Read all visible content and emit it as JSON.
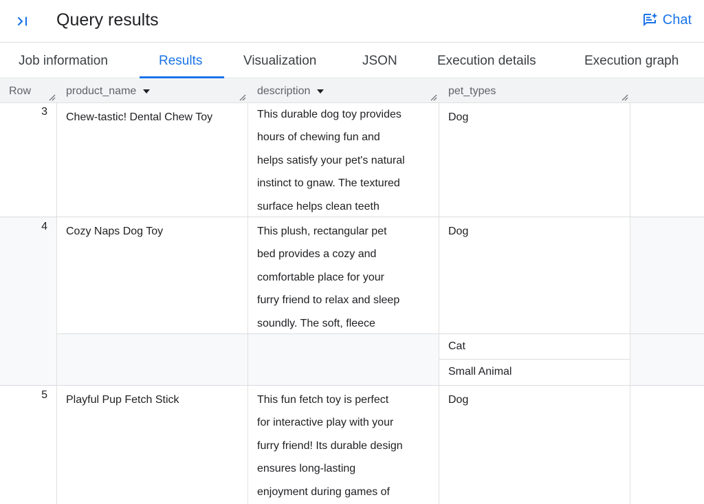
{
  "header": {
    "collapse_icon": "collapse-panel-icon",
    "title": "Query results",
    "chat_label": "Chat",
    "chat_icon": "chat-spark-icon"
  },
  "tabs": [
    {
      "label": "Job information",
      "active": false
    },
    {
      "label": "Results",
      "active": true
    },
    {
      "label": "Visualization",
      "active": false
    },
    {
      "label": "JSON",
      "active": false
    },
    {
      "label": "Execution details",
      "active": false
    },
    {
      "label": "Execution graph",
      "active": false
    }
  ],
  "columns": {
    "row": "Row",
    "product_name": "product_name",
    "description": "description",
    "pet_types": "pet_types"
  },
  "rows": [
    {
      "row": "3",
      "product_name": "Chew-tastic! Dental Chew Toy",
      "description": [
        "This durable dog toy provides",
        "hours of chewing fun and",
        "helps satisfy your pet's natural",
        "instinct to gnaw.  The textured",
        "surface helps clean teeth"
      ],
      "pet_types": [
        "Dog"
      ]
    },
    {
      "row": "4",
      "product_name": "Cozy Naps Dog Toy",
      "description": [
        "This plush, rectangular pet",
        "bed provides a cozy and",
        "comfortable place for your",
        "furry friend to relax and sleep",
        "soundly. The soft, fleece"
      ],
      "pet_types": [
        "Dog",
        "Cat",
        "Small Animal"
      ]
    },
    {
      "row": "5",
      "product_name": "Playful Pup Fetch Stick",
      "description": [
        "This fun fetch toy is perfect",
        "for interactive play with your",
        "furry friend!  Its durable design",
        "ensures long-lasting",
        "enjoyment during games of"
      ],
      "pet_types": [
        "Dog"
      ]
    }
  ],
  "colors": {
    "accent": "#1a73e8",
    "header_bg": "#f1f3f4",
    "alt_row_bg": "#f8f9fa",
    "border": "#dadce0"
  }
}
